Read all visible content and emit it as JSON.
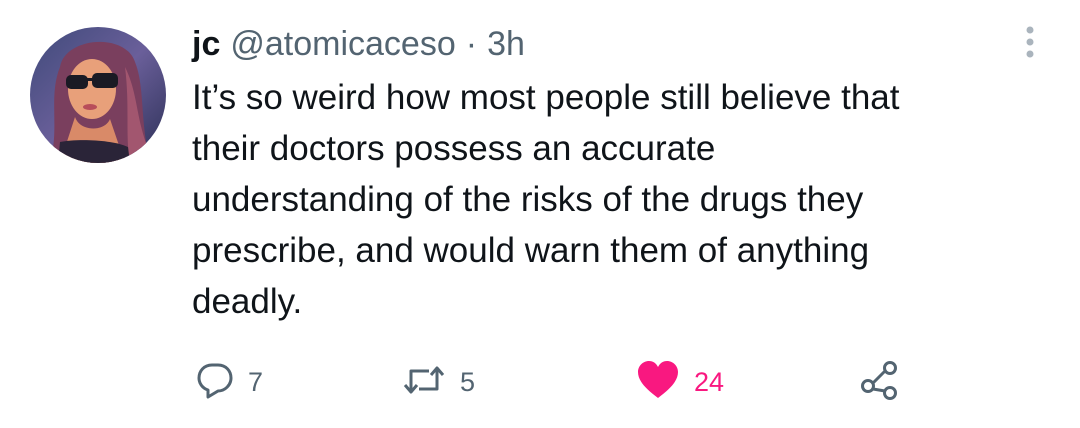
{
  "tweet": {
    "author": {
      "name": "jc",
      "handle": "@atomicaceso"
    },
    "separator": "·",
    "timestamp": "3h",
    "text_lines": [
      "It’s so weird how most people still believe that",
      "their doctors possess an accurate",
      "understanding of the risks of the drugs they",
      "prescribe, and would warn them of anything",
      "deadly."
    ],
    "actions": {
      "reply_count": "7",
      "retweet_count": "5",
      "like_count": "24"
    },
    "icons": {
      "reply": "reply-icon",
      "retweet": "retweet-icon",
      "like": "heart-icon",
      "share": "share-icon",
      "more": "more-icon"
    },
    "colors": {
      "text": "#0f1419",
      "secondary": "#536471",
      "like": "#f91880"
    }
  }
}
